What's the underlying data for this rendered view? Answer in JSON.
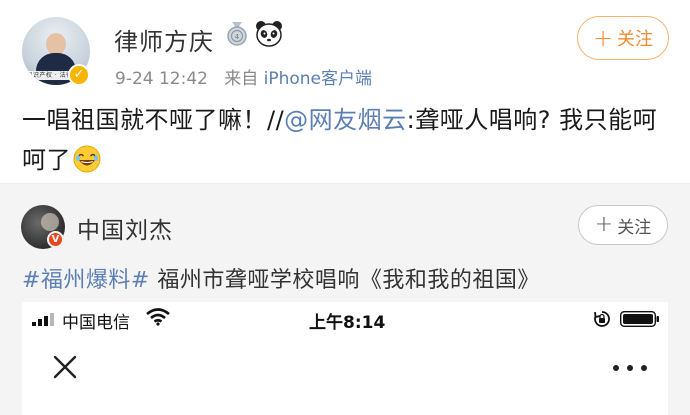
{
  "post": {
    "username": "律师方庆",
    "avatar_caption": "知识产权 · 法律顾问",
    "meta": {
      "time": "9-24 12:42",
      "from_prefix": "来自",
      "source": "iPhone客户端"
    },
    "follow_label": "关注",
    "text": {
      "part1": "一唱祖国就不哑了嘛！//",
      "mention": "@网友烟云",
      "part2": ":聋哑人唱响? 我只能呵呵了"
    }
  },
  "repost": {
    "username": "中国刘杰",
    "follow_label": "关注",
    "hashtag": "#福州爆料#",
    "text": " 福州市聋哑学校唱响《我和我的祖国》"
  },
  "phone": {
    "carrier": "中国电信",
    "time": "上午8:14"
  },
  "colors": {
    "link": "#5b7fb3",
    "follow_orange": "#f08c2e",
    "verified_gold": "#f7b500",
    "verified_red": "#e8471e",
    "repost_bg": "#f4f4f4"
  },
  "icons": [
    "plus-icon",
    "verified-badge-icon",
    "medal-icon",
    "panda-icon",
    "laugh-emoji",
    "signal-icon",
    "wifi-icon",
    "rotation-lock-icon",
    "battery-icon",
    "close-icon",
    "more-icon"
  ]
}
